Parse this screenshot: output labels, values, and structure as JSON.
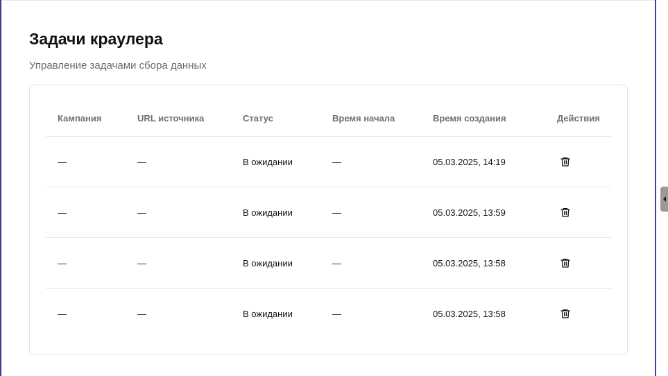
{
  "header": {
    "title": "Задачи краулера",
    "subtitle": "Управление задачами сбора данных"
  },
  "table": {
    "columns": [
      "Кампания",
      "URL источника",
      "Статус",
      "Время начала",
      "Время создания",
      "Действия"
    ],
    "rows": [
      {
        "campaign": "—",
        "source_url": "—",
        "status": "В ожидании",
        "start_time": "—",
        "created_at": "05.03.2025, 14:19",
        "action_icon": "trash-icon"
      },
      {
        "campaign": "—",
        "source_url": "—",
        "status": "В ожидании",
        "start_time": "—",
        "created_at": "05.03.2025, 13:59",
        "action_icon": "trash-icon"
      },
      {
        "campaign": "—",
        "source_url": "—",
        "status": "В ожидании",
        "start_time": "—",
        "created_at": "05.03.2025, 13:58",
        "action_icon": "trash-icon"
      },
      {
        "campaign": "—",
        "source_url": "—",
        "status": "В ожидании",
        "start_time": "—",
        "created_at": "05.03.2025, 13:58",
        "action_icon": "trash-icon"
      }
    ]
  },
  "panel": {
    "collapse_icon": "chevron-left-icon"
  },
  "colors": {
    "frame_border": "#3b3a8c",
    "header_text": "#6f6f6f",
    "divider": "#e6e6e6"
  }
}
